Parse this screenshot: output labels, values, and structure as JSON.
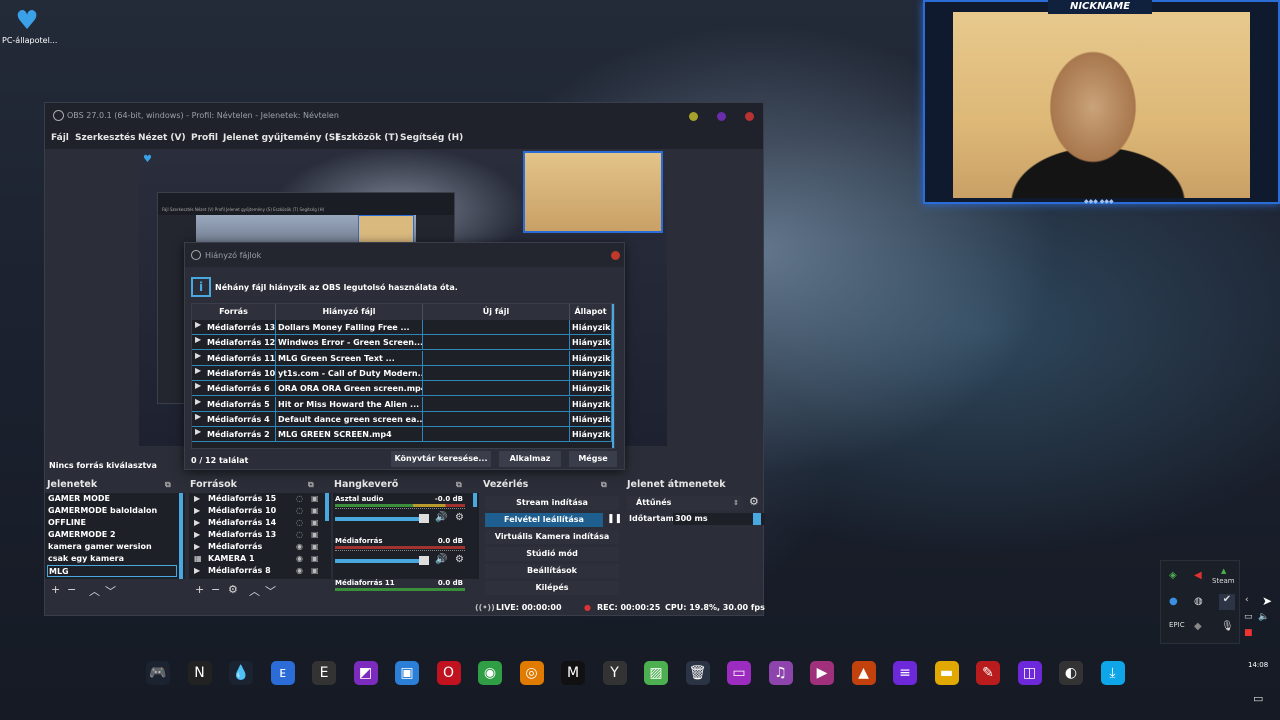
{
  "desktop": {
    "icon_label": "PC-állapotel..."
  },
  "webcam": {
    "name": "NICKNAME"
  },
  "obs": {
    "title": "OBS 27.0.1 (64-bit, windows) - Profil: Névtelen - Jelenetek: Névtelen",
    "menu": [
      "Fájl",
      "Szerkesztés",
      "Nézet (V)",
      "Profil",
      "Jelenet gyűjtemény (S)",
      "Eszközök (T)",
      "Segítség (H)"
    ],
    "no_source": "Nincs forrás kiválasztva",
    "nested_menu": "Fájl  Szerkesztés  Nézet (V)  Profil  Jelenet gyűjtemény (S)  Eszközök (T)  Segítség (H)"
  },
  "dialog": {
    "title": "Hiányzó fájlok",
    "message": "Néhány fájl hiányzik az OBS legutolsó használata óta.",
    "columns": [
      "Forrás",
      "Hiányzó fájl",
      "Új fájl",
      "Állapot"
    ],
    "rows": [
      {
        "source": "Médiaforrás 13",
        "missing": "Dollars Money Falling Free ...",
        "new": "",
        "status": "Hiányzik"
      },
      {
        "source": "Médiaforrás 12",
        "missing": "Windwos Error - Green Screen...",
        "new": "",
        "status": "Hiányzik"
      },
      {
        "source": "Médiaforrás 11",
        "missing": "MLG Green Screen Text ...",
        "new": "",
        "status": "Hiányzik"
      },
      {
        "source": "Médiaforrás 10",
        "missing": "yt1s.com - Call of Duty Modern...",
        "new": "",
        "status": "Hiányzik"
      },
      {
        "source": "Médiaforrás 6",
        "missing": "ORA ORA ORA Green screen.mp4",
        "new": "",
        "status": "Hiányzik"
      },
      {
        "source": "Médiaforrás 5",
        "missing": "Hit or Miss Howard the Alien ...",
        "new": "",
        "status": "Hiányzik"
      },
      {
        "source": "Médiaforrás 4",
        "missing": "Default dance green screen ea...",
        "new": "",
        "status": "Hiányzik"
      },
      {
        "source": "Médiaforrás 2",
        "missing": "MLG GREEN SCREEN.mp4",
        "new": "",
        "status": "Hiányzik"
      }
    ],
    "found": "0 / 12 találat",
    "buttons": {
      "search": "Könyvtár keresése...",
      "apply": "Alkalmaz",
      "cancel": "Mégse"
    }
  },
  "docks": {
    "scenes": {
      "title": "Jelenetek",
      "items": [
        "GAMER MODE",
        "GAMERMODE baloldalon",
        "OFFLINE",
        "GAMERMODE 2",
        "kamera gamer wersion",
        "csak egy kamera",
        "MLG"
      ]
    },
    "sources": {
      "title": "Források",
      "items": [
        {
          "name": "Médiaforrás 15",
          "icon": "play-icon"
        },
        {
          "name": "Médiaforrás 10",
          "icon": "play-icon"
        },
        {
          "name": "Médiaforrás 14",
          "icon": "play-icon"
        },
        {
          "name": "Médiaforrás 13",
          "icon": "play-icon"
        },
        {
          "name": "Médiaforrás",
          "icon": "play-icon"
        },
        {
          "name": "KAMERA 1",
          "icon": "camera-icon"
        },
        {
          "name": "Médiaforrás 8",
          "icon": "play-icon"
        }
      ]
    },
    "mixer": {
      "title": "Hangkeverő",
      "channels": [
        {
          "name": "Asztal audio",
          "db": "-0.0 dB"
        },
        {
          "name": "Médiaforrás",
          "db": "0.0 dB"
        },
        {
          "name": "Médiaforrás 11",
          "db": "0.0 dB"
        }
      ]
    },
    "controls": {
      "title": "Vezérlés",
      "buttons": [
        "Stream indítása",
        "Felvétel leállítása",
        "Virtuális Kamera indítása",
        "Stúdió mód",
        "Beállítások",
        "Kilépés"
      ]
    },
    "transitions": {
      "title": "Jelenet átmenetek",
      "selected": "Áttűnés",
      "duration_label": "Időtartam",
      "duration_value": "300 ms"
    }
  },
  "status": {
    "live": "LIVE: 00:00:00",
    "rec": "REC: 00:00:25",
    "cpu": "CPU: 19.8%, 30.00 fps"
  },
  "tray": {
    "steam_label": "Steam"
  },
  "clock": "14:08",
  "taskbar": [
    "gamepad-icon",
    "nexus-icon",
    "drop-icon",
    "ea-icon",
    "epic-games-icon",
    "purple-app-icon",
    "blue-app-icon",
    "opera-icon",
    "chrome-icon",
    "orange-app-icon",
    "mw-icon",
    "destiny-icon",
    "image-icon",
    "recycle-bin-icon",
    "monitor-icon",
    "music-icon",
    "video-icon",
    "photo-icon",
    "notes-icon",
    "folder-icon",
    "pen-icon",
    "media-icon",
    "obs-icon",
    "download-icon"
  ]
}
